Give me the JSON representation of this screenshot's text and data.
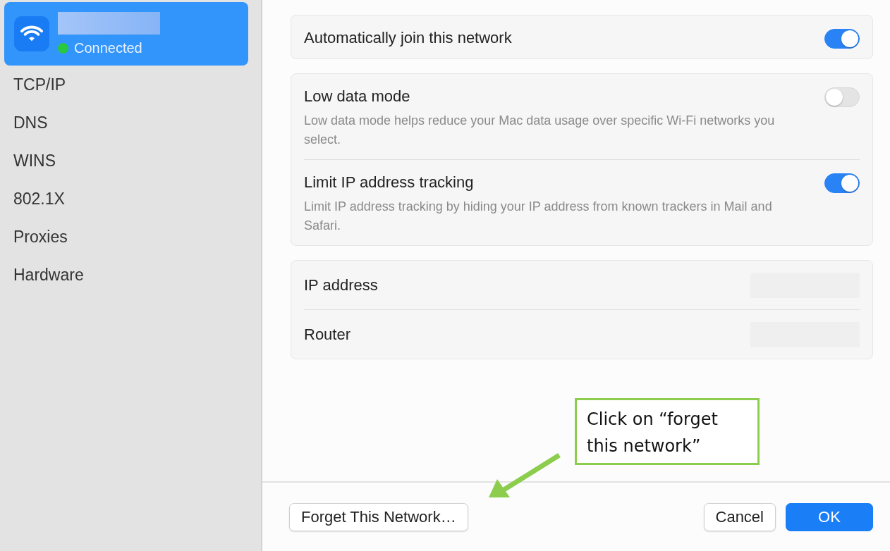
{
  "sidebar": {
    "network": {
      "status": "Connected",
      "color": "#28c840",
      "selected": true
    },
    "items": [
      {
        "label": "TCP/IP",
        "selected": false
      },
      {
        "label": "DNS",
        "selected": false
      },
      {
        "label": "WINS",
        "selected": false
      },
      {
        "label": "802.1X",
        "selected": false
      },
      {
        "label": "Proxies",
        "selected": false
      },
      {
        "label": "Hardware",
        "selected": false
      }
    ]
  },
  "cards": [
    {
      "rows": [
        {
          "kind": "toggle",
          "title": "Automatically join this network",
          "on": true
        }
      ]
    },
    {
      "rows": [
        {
          "kind": "toggle",
          "title": "Low data mode",
          "description": "Low data mode helps reduce your Mac data usage over specific Wi-Fi networks you select.",
          "on": false
        },
        {
          "kind": "toggle",
          "title": "Limit IP address tracking",
          "description": "Limit IP address tracking by hiding your IP address from known trackers in Mail and Safari.",
          "on": true
        }
      ]
    },
    {
      "rows": [
        {
          "kind": "info",
          "title": "IP address"
        },
        {
          "kind": "info",
          "title": "Router"
        }
      ]
    }
  ],
  "buttons": [
    {
      "label": "Forget This Network…",
      "kind": "default"
    },
    {
      "label": "Cancel",
      "kind": "default"
    },
    {
      "label": "OK",
      "kind": "primary"
    }
  ],
  "annotation": {
    "text": "Click on “forget this network”"
  }
}
